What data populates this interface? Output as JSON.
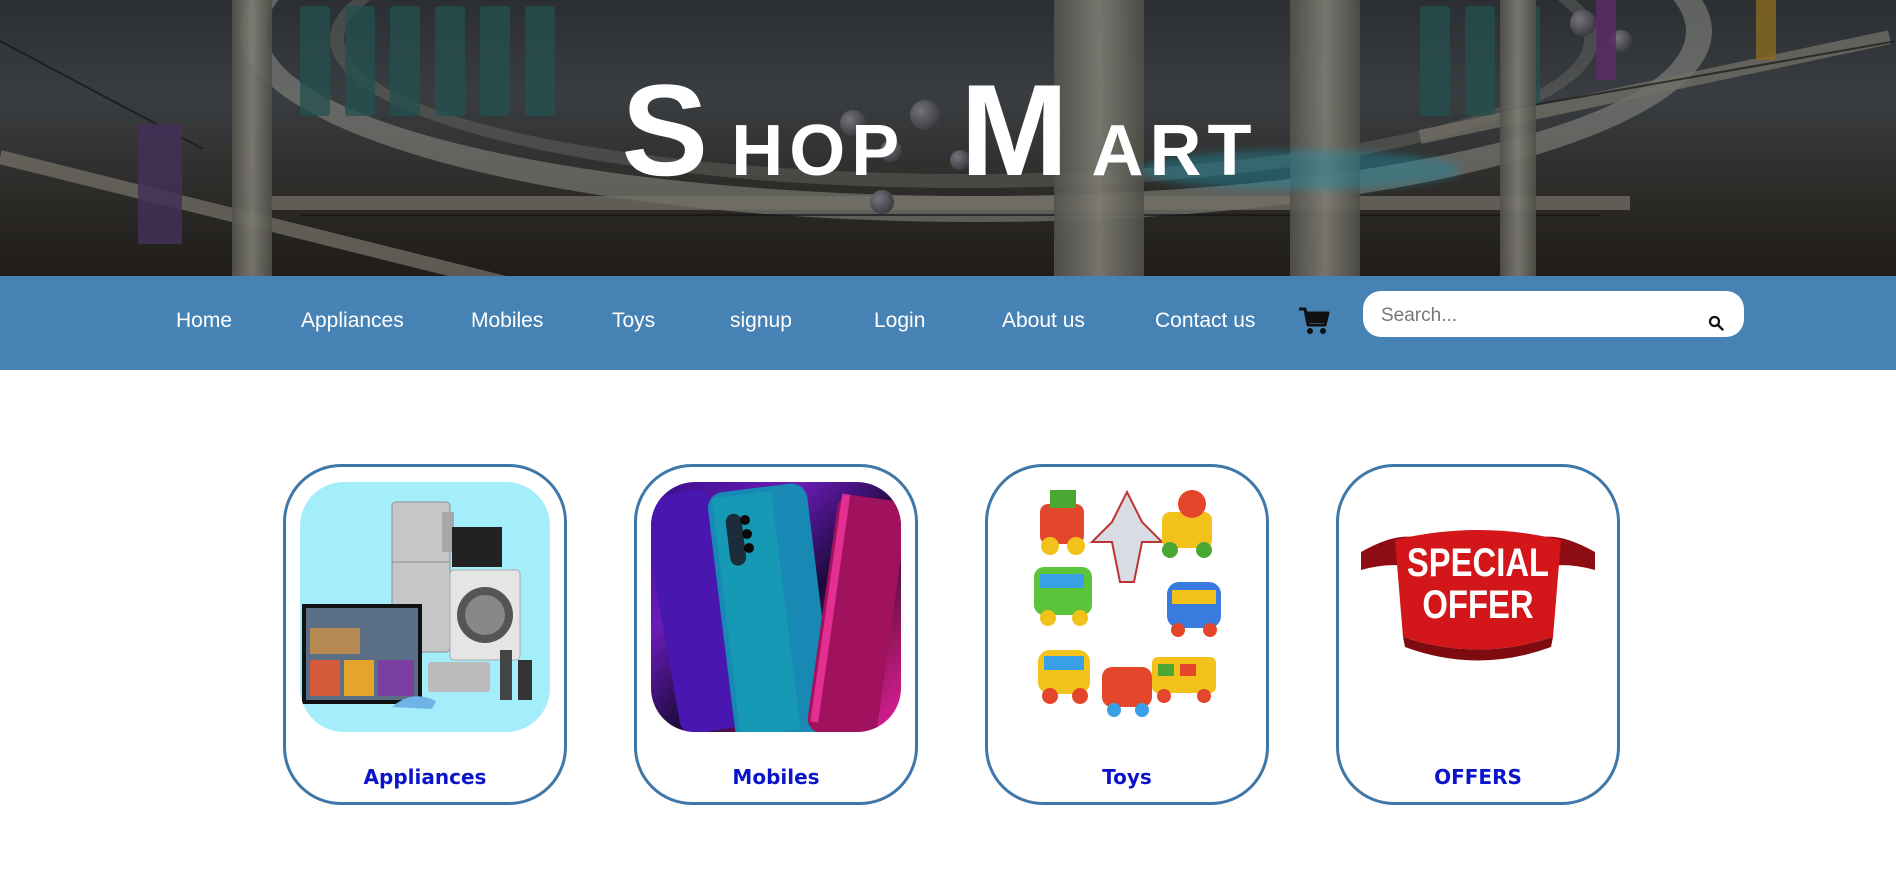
{
  "brand": {
    "title_parts": [
      {
        "cap": "S",
        "rest": "HOP"
      },
      {
        "cap": "M",
        "rest": "ART"
      }
    ]
  },
  "nav": {
    "links": [
      "Home",
      "Appliances",
      "Mobiles",
      "Toys",
      "signup",
      "Login",
      "About us",
      "Contact us"
    ],
    "cart_icon": "shopping-cart-icon"
  },
  "search": {
    "placeholder": "Search...",
    "icon": "search-icon"
  },
  "categories": [
    {
      "label": "Appliances",
      "image": "appliances-image"
    },
    {
      "label": "Mobiles",
      "image": "mobiles-image"
    },
    {
      "label": "Toys",
      "image": "toys-image"
    },
    {
      "label": "OFFERS",
      "image": "special-offer-image",
      "image_text": [
        "SPECIAL",
        "OFFER"
      ]
    }
  ],
  "colors": {
    "nav_background": "#4682b4",
    "card_border": "#3f78a8",
    "card_label": "#0b14c9",
    "offer_red": "#d3161a"
  }
}
